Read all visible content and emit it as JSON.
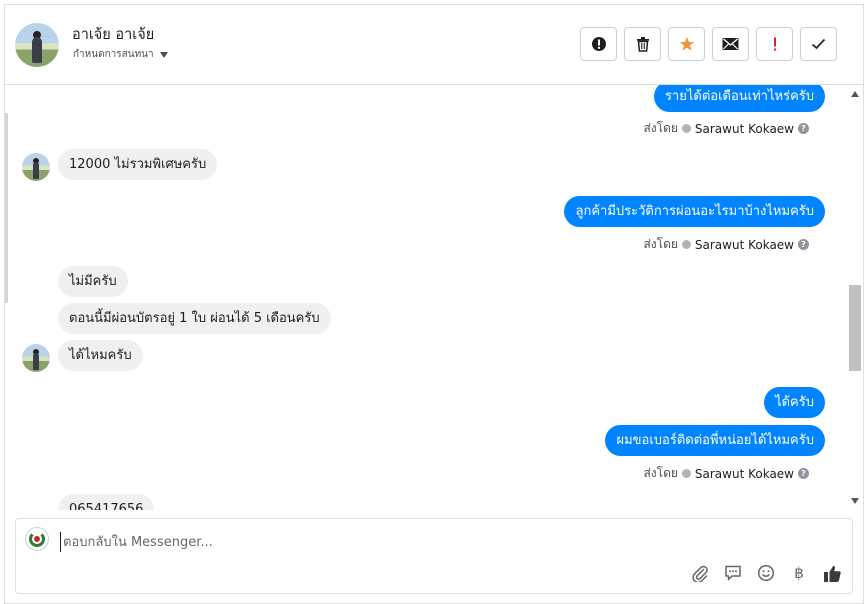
{
  "header": {
    "contact_name": "อาเจ้ย อาเจ้ย",
    "assign_label": "กำหนดการสนทนา",
    "toolbar": [
      {
        "name": "mark-important-button",
        "icon": "alert-circle-icon"
      },
      {
        "name": "delete-button",
        "icon": "trash-icon"
      },
      {
        "name": "follow-up-button",
        "icon": "star-icon"
      },
      {
        "name": "mark-unread-button",
        "icon": "envelope-icon"
      },
      {
        "name": "mark-spam-button",
        "icon": "exclamation-icon"
      },
      {
        "name": "mark-done-button",
        "icon": "check-icon"
      }
    ]
  },
  "messages": [
    {
      "dir": "out",
      "text": "รายได้ต่อเดือนเท่าไหร่ครับ"
    },
    {
      "dir": "in",
      "text": "12000 ไม่รวมพิเศษครับ"
    },
    {
      "dir": "out",
      "text": "ลูกค้ามีประวัติการผ่อนอะไรมาบ้างไหมครับ"
    },
    {
      "dir": "in",
      "text": "ไม่มีครับ"
    },
    {
      "dir": "in",
      "text": "ตอนนี้มีผ่อนบัตรอยู่ 1 ใบ ผ่อนได้ 5 เดือนครับ"
    },
    {
      "dir": "in",
      "text": "ได้ไหมครับ"
    },
    {
      "dir": "out",
      "text": "ได้ครับ"
    },
    {
      "dir": "out",
      "text": "ผมขอเบอร์ติดต่อพี่หน่อยได้ไหมครับ"
    },
    {
      "dir": "in",
      "text": "065417656"
    }
  ],
  "sent_by": {
    "prefix": "ส่งโดย",
    "agent": "Sarawut Kokaew",
    "help": "?"
  },
  "composer": {
    "placeholder": "ตอบกลับใน Messenger...",
    "tools": [
      "paperclip-icon",
      "speech-bubble-icon",
      "smiley-icon",
      "baht-icon",
      "thumbs-up-icon"
    ],
    "baht_symbol": "฿"
  },
  "colors": {
    "outgoing_bubble": "#0084ff",
    "incoming_bubble": "#f1f0f0",
    "follow_up_star": "#f7923a",
    "spam_exclamation": "#e02020"
  }
}
